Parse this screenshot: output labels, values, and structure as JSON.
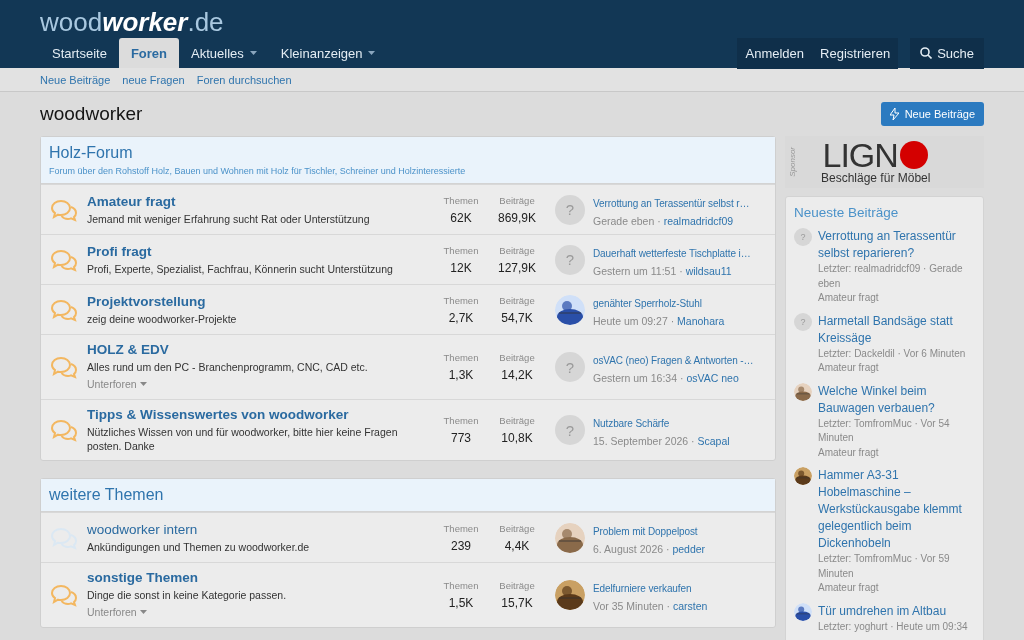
{
  "logo": [
    {
      "text": "wood",
      "kind": "light"
    },
    {
      "text": "worker",
      "kind": "strong"
    },
    {
      "text": ".de",
      "kind": "light"
    }
  ],
  "nav": {
    "tabs": [
      {
        "label": "Startseite",
        "selected": false,
        "menu": false
      },
      {
        "label": "Foren",
        "selected": true,
        "menu": false
      },
      {
        "label": "Aktuelles",
        "selected": false,
        "menu": true
      },
      {
        "label": "Kleinanzeigen",
        "selected": false,
        "menu": true
      }
    ],
    "account": [
      "Anmelden",
      "Registrieren"
    ],
    "search": "Suche"
  },
  "subnav": [
    "Neue Beiträge",
    "neue Fragen",
    "Foren durchsuchen"
  ],
  "page_title": "woodworker",
  "new_posts_button": "Neue Beiträge",
  "categories": [
    {
      "title": "Holz-Forum",
      "description": "Forum über den Rohstoff Holz, Bauen und Wohnen mit Holz für Tischler, Schreiner und Holzinteressierte",
      "forums": [
        {
          "title": "Amateur fragt",
          "description": "Jemand mit weniger Erfahrung sucht Rat oder Unterstützung",
          "unread": true,
          "stats": [
            {
              "label": "Themen",
              "value": "62K"
            },
            {
              "label": "Beiträge",
              "value": "869,9K"
            }
          ],
          "last": {
            "avatar": {
              "kind": "placeholder",
              "text": "?"
            },
            "title": "Verrottung an Terassentür selbst r…",
            "time": "Gerade eben",
            "separator": "·",
            "user": "realmadridcf09"
          }
        },
        {
          "title": "Profi fragt",
          "description": "Profi, Experte, Spezialist, Fachfrau, Könnerin sucht Unterstützung",
          "unread": true,
          "stats": [
            {
              "label": "Themen",
              "value": "12K"
            },
            {
              "label": "Beiträge",
              "value": "127,9K"
            }
          ],
          "last": {
            "avatar": {
              "kind": "placeholder",
              "text": "?"
            },
            "title": "Dauerhaft wetterfeste Tischplatte i…",
            "time": "Gestern um 11:51",
            "separator": "·",
            "user": "wildsau11"
          }
        },
        {
          "title": "Projektvorstellung",
          "description": "zeig deine woodworker-Projekte",
          "unread": true,
          "stats": [
            {
              "label": "Themen",
              "value": "2,7K"
            },
            {
              "label": "Beiträge",
              "value": "54,7K"
            }
          ],
          "last": {
            "title": "genähter Sperrholz-Stuhl",
            "time": "Heute um 09:27",
            "separator": "·",
            "user": "Manohara"
          }
        },
        {
          "title": "HOLZ & EDV",
          "description": "Alles rund um den PC - Branchenprogramm, CNC, CAD etc.",
          "subforums": "Unterforen",
          "unread": true,
          "stats": [
            {
              "label": "Themen",
              "value": "1,3K"
            },
            {
              "label": "Beiträge",
              "value": "14,2K"
            }
          ],
          "last": {
            "avatar": {
              "kind": "placeholder",
              "text": "?"
            },
            "title": "osVAC (neo) Fragen & Antworten -…",
            "time": "Gestern um 16:34",
            "separator": "·",
            "user": "osVAC neo"
          }
        },
        {
          "title": "Tipps & Wissenswertes von woodworker",
          "description": "Nützliches Wissen von und für woodworker, bitte hier keine Fragen posten. Danke",
          "unread": true,
          "stats": [
            {
              "label": "Themen",
              "value": "773"
            },
            {
              "label": "Beiträge",
              "value": "10,8K"
            }
          ],
          "last": {
            "avatar": {
              "kind": "placeholder",
              "text": "?"
            },
            "title": "Nutzbare Schärfe",
            "time": "15. September 2026",
            "separator": "·",
            "user": "Scapal"
          }
        }
      ]
    },
    {
      "title": "weitere Themen",
      "forums": [
        {
          "title": "woodworker intern",
          "description": "Ankündigungen und Themen zu woodworker.de",
          "unread": false,
          "stats": [
            {
              "label": "Themen",
              "value": "239"
            },
            {
              "label": "Beiträge",
              "value": "4,4K"
            }
          ],
          "last": {
            "title": "Problem mit Doppelpost",
            "time": "6. August 2026",
            "separator": "·",
            "user": "pedder"
          }
        },
        {
          "title": "sonstige Themen",
          "description": "Dinge die sonst in keine Kategorie passen.",
          "subforums": "Unterforen",
          "unread": true,
          "stats": [
            {
              "label": "Themen",
              "value": "1,5K"
            },
            {
              "label": "Beiträge",
              "value": "15,7K"
            }
          ],
          "last": {
            "title": "Edelfurniere verkaufen",
            "time": "Vor 35 Minuten",
            "separator": "·",
            "user": "carsten"
          }
        }
      ]
    }
  ],
  "sponsor": {
    "label": "Sponsor",
    "brand": "LIGN",
    "tagline": "Beschläge für Möbel"
  },
  "latest": {
    "title": "Neueste Beiträge",
    "items": [
      {
        "avatar": {
          "kind": "placeholder",
          "text": "?"
        },
        "title": "Verrottung an Terassentür selbst reparieren?",
        "meta": "Letzter: realmadridcf09 · Gerade eben",
        "forum": "Amateur fragt"
      },
      {
        "avatar": {
          "kind": "placeholder",
          "text": "?"
        },
        "title": "Harmetall Bandsäge statt Kreissäge",
        "meta": "Letzter: Dackeldil · Vor 6 Minuten",
        "forum": "Amateur fragt"
      },
      {
        "title": "Welche Winkel beim Bauwagen verbauen?",
        "meta": "Letzter: TomfromMuc · Vor 54 Minuten",
        "forum": "Amateur fragt"
      },
      {
        "title": "Hammer A3-31 Hobelmaschine – Werkstückausgabe klemmt gelegentlich beim Dickenhobeln",
        "meta": "Letzter: TomfromMuc · Vor 59 Minuten",
        "forum": "Amateur fragt"
      },
      {
        "title": "Tür umdrehen im Altbau",
        "meta": "Letzter: yoghurt · Heute um 09:34"
      }
    ]
  }
}
